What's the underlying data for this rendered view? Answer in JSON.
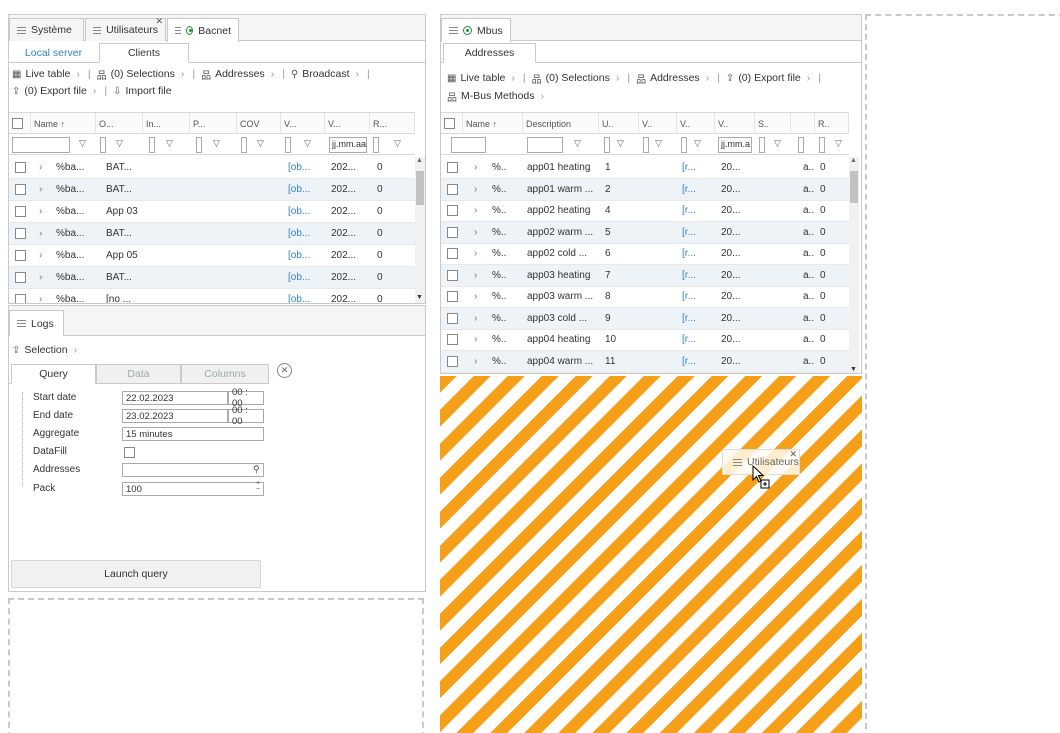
{
  "left_window": {
    "tabs": [
      {
        "label": "Système"
      },
      {
        "label": "Utilisateurs"
      },
      {
        "label": "Bacnet"
      }
    ],
    "subtabs": [
      "Local server",
      "Clients"
    ],
    "toolbar": {
      "live_table": "Live table",
      "selections": "(0) Selections",
      "addresses": "Addresses",
      "broadcast": "Broadcast",
      "export_file": "(0) Export file",
      "import_file": "Import file"
    },
    "columns": [
      "Name ↑",
      "O...",
      "In...",
      "P...",
      "COV",
      "V...",
      "V...",
      "R..."
    ],
    "date_filter": "jj.mm.aa",
    "rows": [
      {
        "name": "%ba...",
        "o": "BAT...",
        "v1": "[ob...",
        "v2": "202...",
        "r": "0"
      },
      {
        "name": "%ba...",
        "o": "BAT...",
        "v1": "[ob...",
        "v2": "202...",
        "r": "0"
      },
      {
        "name": "%ba...",
        "o": "App 03",
        "v1": "[ob...",
        "v2": "202...",
        "r": "0"
      },
      {
        "name": "%ba...",
        "o": "BAT...",
        "v1": "[ob...",
        "v2": "202...",
        "r": "0"
      },
      {
        "name": "%ba...",
        "o": "App 05",
        "v1": "[ob...",
        "v2": "202...",
        "r": "0"
      },
      {
        "name": "%ba...",
        "o": "BAT...",
        "v1": "[ob...",
        "v2": "202...",
        "r": "0"
      },
      {
        "name": "%ba...",
        "o": "[no ...",
        "v1": "[ob...",
        "v2": "202...",
        "r": "0"
      }
    ]
  },
  "logs_window": {
    "tab": "Logs",
    "selection": "Selection",
    "subtabs": [
      "Query",
      "Data",
      "Columns"
    ],
    "fields": {
      "start_date_label": "Start date",
      "start_date": "22.02.2023",
      "start_time": "00 : 00",
      "end_date_label": "End date",
      "end_date": "23.02.2023",
      "end_time": "00 : 00",
      "aggregate_label": "Aggregate",
      "aggregate": "15 minutes",
      "datafill_label": "DataFill",
      "addresses_label": "Addresses",
      "addresses": "",
      "pack_label": "Pack",
      "pack": "100"
    },
    "launch": "Launch query"
  },
  "right_window": {
    "tab": "Mbus",
    "subtab": "Addresses",
    "toolbar": {
      "live_table": "Live table",
      "selections": "(0) Selections",
      "addresses": "Addresses",
      "export_file": "(0) Export file",
      "mbus_methods": "M-Bus Methods"
    },
    "columns": [
      "Name ↑",
      "Description",
      "U..",
      "V..",
      "V..",
      "V..",
      "S..",
      "",
      "R.."
    ],
    "date_filter": "jj.mm.a",
    "rows": [
      {
        "name": "%..",
        "desc": "app01 heating",
        "u": "1",
        "v": "[r...",
        "d": "20...",
        "s": "a..",
        "r": "0"
      },
      {
        "name": "%..",
        "desc": "app01 warm ...",
        "u": "2",
        "v": "[r...",
        "d": "20...",
        "s": "a..",
        "r": "0"
      },
      {
        "name": "%..",
        "desc": "app02 heating",
        "u": "4",
        "v": "[r...",
        "d": "20...",
        "s": "a..",
        "r": "0"
      },
      {
        "name": "%..",
        "desc": "app02 warm ...",
        "u": "5",
        "v": "[r...",
        "d": "20...",
        "s": "a..",
        "r": "0"
      },
      {
        "name": "%..",
        "desc": "app02 cold ...",
        "u": "6",
        "v": "[r...",
        "d": "20...",
        "s": "a..",
        "r": "0"
      },
      {
        "name": "%..",
        "desc": "app03 heating",
        "u": "7",
        "v": "[r...",
        "d": "20...",
        "s": "a..",
        "r": "0"
      },
      {
        "name": "%..",
        "desc": "app03 warm ...",
        "u": "8",
        "v": "[r...",
        "d": "20...",
        "s": "a..",
        "r": "0"
      },
      {
        "name": "%..",
        "desc": "app03 cold ...",
        "u": "9",
        "v": "[r...",
        "d": "20...",
        "s": "a..",
        "r": "0"
      },
      {
        "name": "%..",
        "desc": "app04 heating",
        "u": "10",
        "v": "[r...",
        "d": "20...",
        "s": "a..",
        "r": "0"
      },
      {
        "name": "%..",
        "desc": "app04 warm ...",
        "u": "11",
        "v": "[r...",
        "d": "20...",
        "s": "a..",
        "r": "0"
      }
    ]
  },
  "drag_ghost": {
    "label": "Utilisateurs"
  },
  "colors": {
    "accent": "#2f7fcf",
    "drop_zone": "#f6a01a",
    "status_dot": "#2a8a3a"
  }
}
